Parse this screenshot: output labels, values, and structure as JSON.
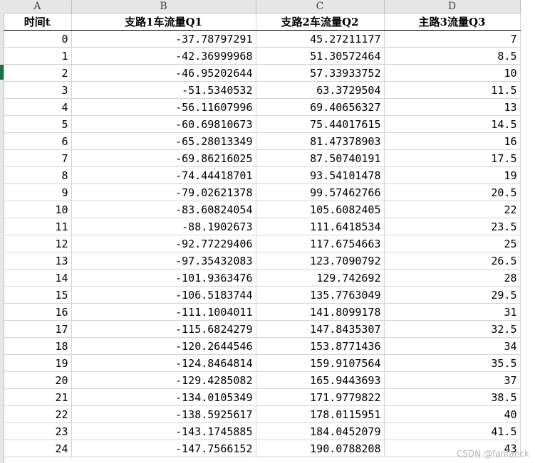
{
  "sheet": {
    "columns": [
      "A",
      "B",
      "C",
      "D"
    ],
    "headers": [
      "时间t",
      "支路1车流量Q1",
      "支路2车流量Q2",
      "主路3流量Q3"
    ],
    "rows": [
      [
        "0",
        "-37.78797291",
        "45.27211177",
        "7"
      ],
      [
        "1",
        "-42.36999968",
        "51.30572464",
        "8.5"
      ],
      [
        "2",
        "-46.95202644",
        "57.33933752",
        "10"
      ],
      [
        "3",
        "-51.5340532",
        "63.3729504",
        "11.5"
      ],
      [
        "4",
        "-56.11607996",
        "69.40656327",
        "13"
      ],
      [
        "5",
        "-60.69810673",
        "75.44017615",
        "14.5"
      ],
      [
        "6",
        "-65.28013349",
        "81.47378903",
        "16"
      ],
      [
        "7",
        "-69.86216025",
        "87.50740191",
        "17.5"
      ],
      [
        "8",
        "-74.44418701",
        "93.54101478",
        "19"
      ],
      [
        "9",
        "-79.02621378",
        "99.57462766",
        "20.5"
      ],
      [
        "10",
        "-83.60824054",
        "105.6082405",
        "22"
      ],
      [
        "11",
        "-88.1902673",
        "111.6418534",
        "23.5"
      ],
      [
        "12",
        "-92.77229406",
        "117.6754663",
        "25"
      ],
      [
        "13",
        "-97.35432083",
        "123.7090792",
        "26.5"
      ],
      [
        "14",
        "-101.9363476",
        "129.742692",
        "28"
      ],
      [
        "15",
        "-106.5183744",
        "135.7763049",
        "29.5"
      ],
      [
        "16",
        "-111.1004011",
        "141.8099178",
        "31"
      ],
      [
        "17",
        "-115.6824279",
        "147.8435307",
        "32.5"
      ],
      [
        "18",
        "-120.2644546",
        "153.8771436",
        "34"
      ],
      [
        "19",
        "-124.8464814",
        "159.9107564",
        "35.5"
      ],
      [
        "20",
        "-129.4285082",
        "165.9443693",
        "37"
      ],
      [
        "21",
        "-134.0105349",
        "171.9779822",
        "38.5"
      ],
      [
        "22",
        "-138.5925617",
        "178.0115951",
        "40"
      ],
      [
        "23",
        "-143.1745885",
        "184.0452079",
        "41.5"
      ],
      [
        "24",
        "-147.7566152",
        "190.0788208",
        "43"
      ]
    ]
  },
  "watermark": "CSDN @fanfanck"
}
